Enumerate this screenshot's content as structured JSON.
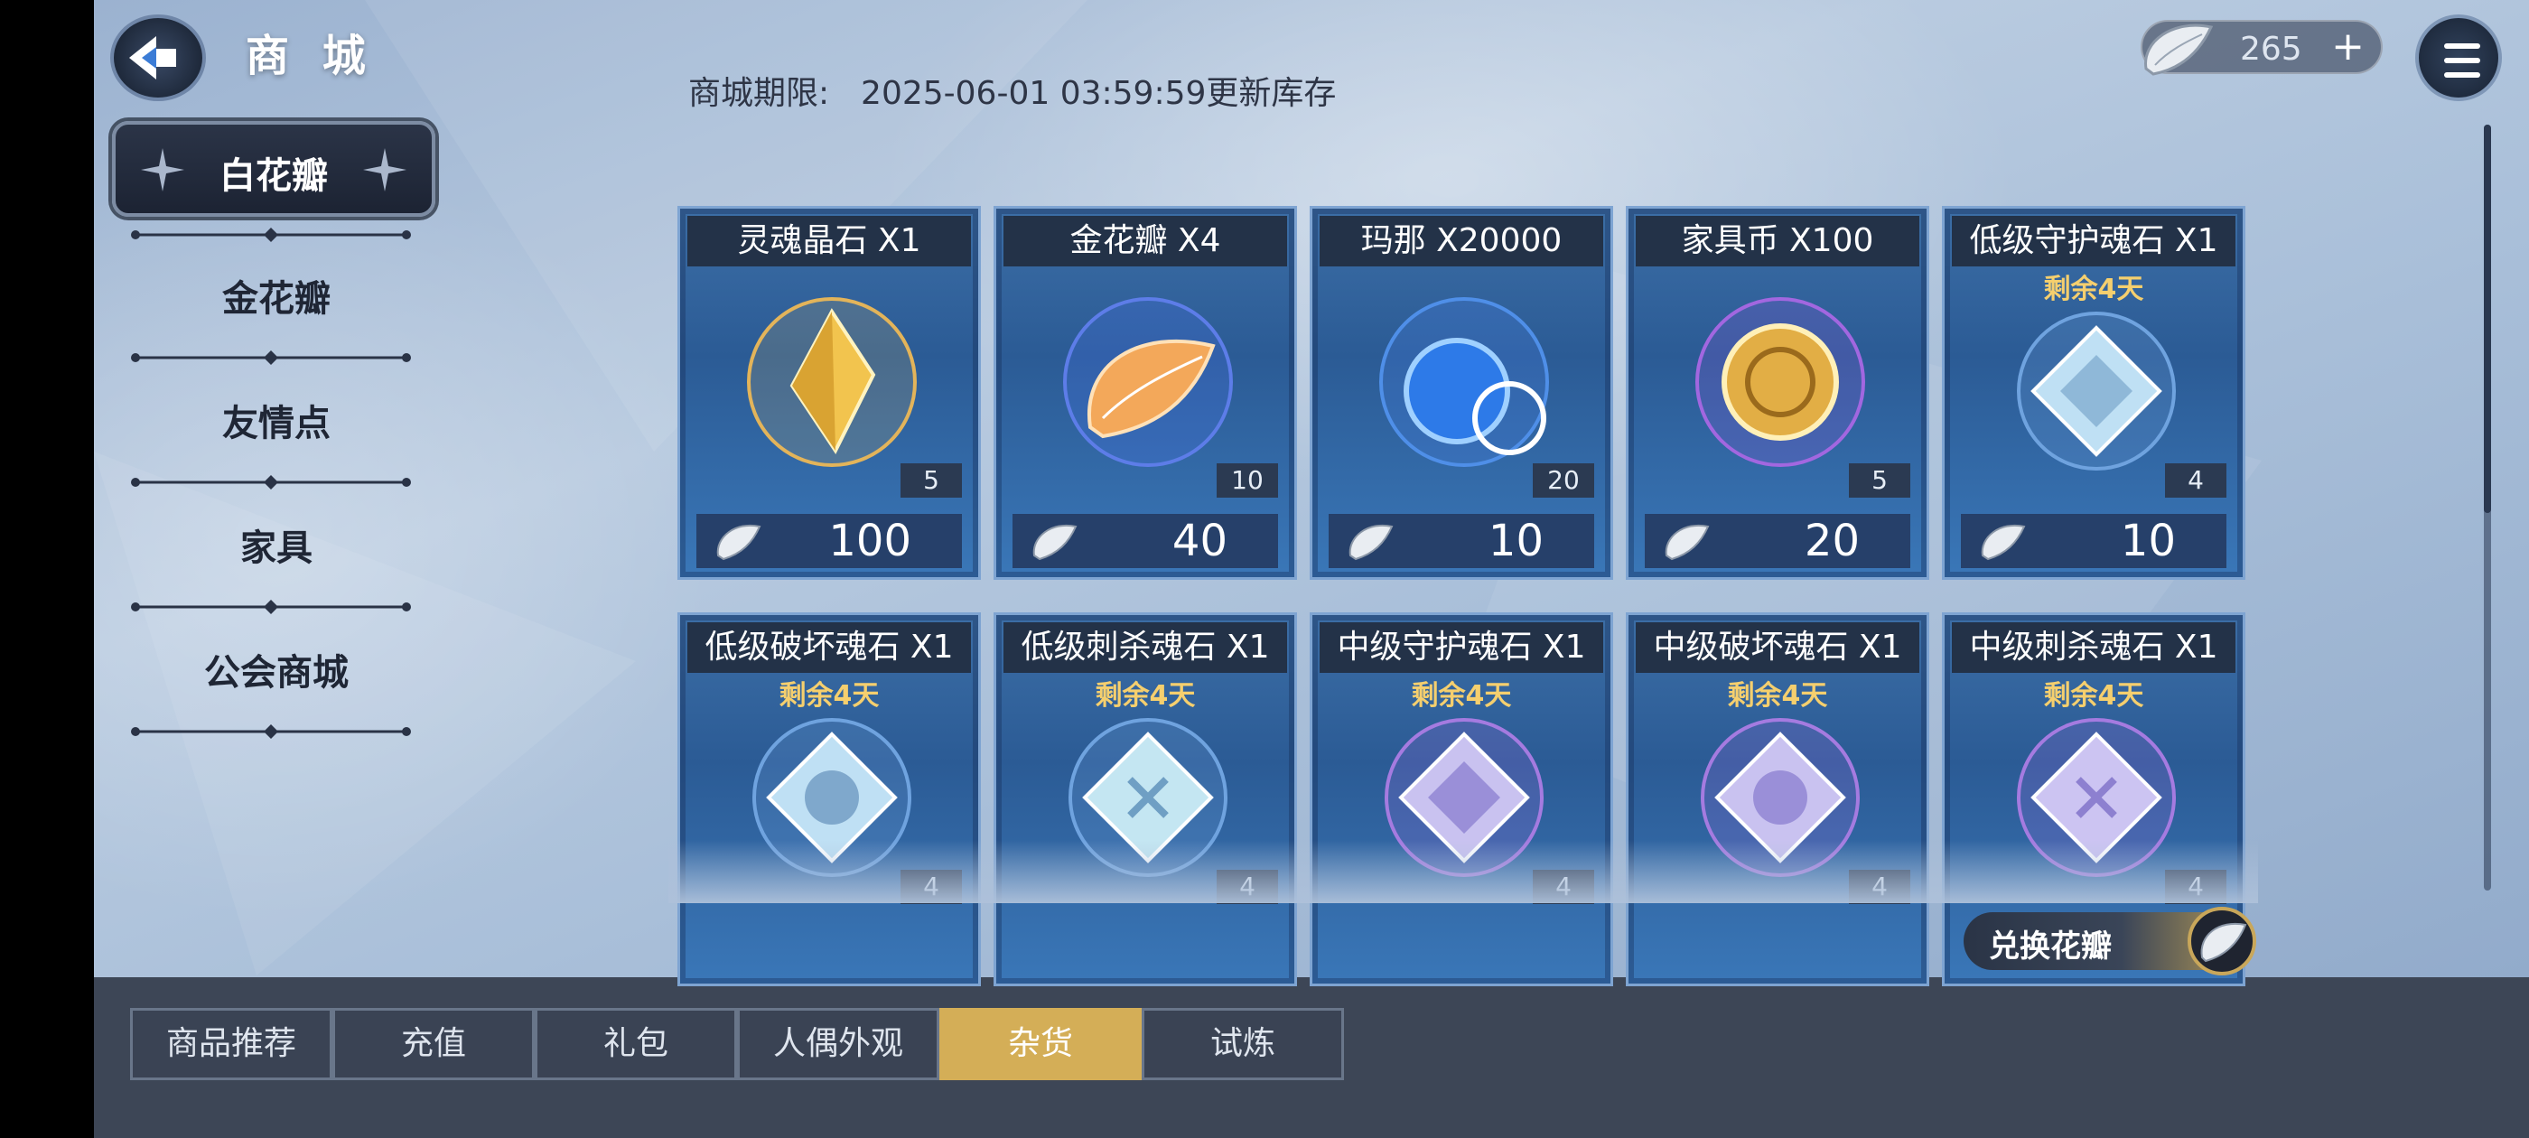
{
  "header": {
    "title": "商 城",
    "expire_label": "商城期限:",
    "expire_value": "2025-06-01 03:59:59更新库存"
  },
  "currency": {
    "amount": "265"
  },
  "sidebar": {
    "items": [
      {
        "label": "白花瓣",
        "active": true
      },
      {
        "label": "金花瓣"
      },
      {
        "label": "友情点"
      },
      {
        "label": "家具"
      },
      {
        "label": "公会商城"
      }
    ]
  },
  "products": [
    {
      "name": "灵魂晶石 X1",
      "remain": "",
      "stock": "5",
      "price": "100",
      "icon": "crystal-icon"
    },
    {
      "name": "金花瓣 X4",
      "remain": "",
      "stock": "10",
      "price": "40",
      "icon": "gold-petal-icon"
    },
    {
      "name": "玛那 X20000",
      "remain": "",
      "stock": "20",
      "price": "10",
      "icon": "mana-icon"
    },
    {
      "name": "家具币 X100",
      "remain": "",
      "stock": "5",
      "price": "20",
      "icon": "furniture-coin-icon"
    },
    {
      "name": "低级守护魂石 X1",
      "remain": "剩余4天",
      "stock": "4",
      "price": "10",
      "icon": "guard-soulstone-icon"
    },
    {
      "name": "低级破坏魂石 X1",
      "remain": "剩余4天",
      "stock": "4",
      "price": "",
      "icon": "destroy-soulstone-icon"
    },
    {
      "name": "低级刺杀魂石 X1",
      "remain": "剩余4天",
      "stock": "4",
      "price": "",
      "icon": "assassin-soulstone-icon"
    },
    {
      "name": "中级守护魂石 X1",
      "remain": "剩余4天",
      "stock": "4",
      "price": "",
      "icon": "guard-soulstone-icon"
    },
    {
      "name": "中级破坏魂石 X1",
      "remain": "剩余4天",
      "stock": "4",
      "price": "",
      "icon": "destroy-soulstone-icon"
    },
    {
      "name": "中级刺杀魂石 X1",
      "remain": "剩余4天",
      "stock": "4",
      "price": "",
      "icon": "assassin-soulstone-icon"
    }
  ],
  "exchange": {
    "label": "兑换花瓣"
  },
  "tabs": [
    {
      "label": "商品推荐"
    },
    {
      "label": "充值"
    },
    {
      "label": "礼包"
    },
    {
      "label": "人偶外观"
    },
    {
      "label": "杂货",
      "active": true
    },
    {
      "label": "试炼"
    }
  ],
  "colors": {
    "accent_gold": "#d4ae57",
    "remain_text": "#f5cf6e",
    "card_blue": "#2b5b95"
  }
}
